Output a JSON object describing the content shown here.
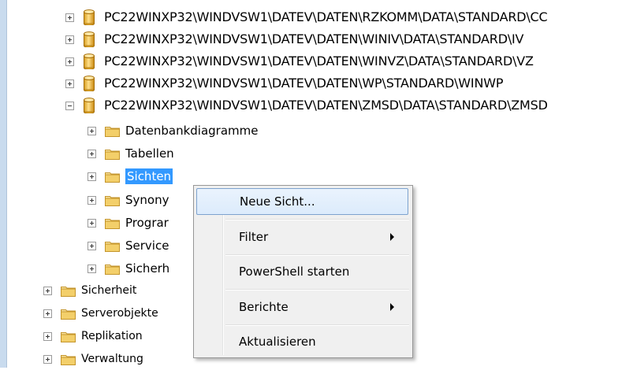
{
  "tree": {
    "databases": [
      {
        "label": "PC22WINXP32\\WINDVSW1\\DATEV\\DATEN\\RZKOMM\\DATA\\STANDARD\\CC",
        "expanded": false
      },
      {
        "label": "PC22WINXP32\\WINDVSW1\\DATEV\\DATEN\\WINIV\\DATA\\STANDARD\\IV",
        "expanded": false
      },
      {
        "label": "PC22WINXP32\\WINDVSW1\\DATEV\\DATEN\\WINVZ\\DATA\\STANDARD\\VZ",
        "expanded": false
      },
      {
        "label": "PC22WINXP32\\WINDVSW1\\DATEV\\DATEN\\WP\\STANDARD\\WINWP",
        "expanded": false
      },
      {
        "label": "PC22WINXP32\\WINDVSW1\\DATEV\\DATEN\\ZMSD\\DATA\\STANDARD\\ZMSD",
        "expanded": true
      }
    ],
    "zmsd_children": [
      {
        "label": "Datenbankdiagramme"
      },
      {
        "label": "Tabellen"
      },
      {
        "label": "Sichten",
        "selected": true
      },
      {
        "label": "Synony"
      },
      {
        "label": "Prograr"
      },
      {
        "label": "Service"
      },
      {
        "label": "Sicherh"
      }
    ],
    "server_nodes": [
      {
        "label": "Sicherheit"
      },
      {
        "label": "Serverobjekte"
      },
      {
        "label": "Replikation"
      },
      {
        "label": "Verwaltung"
      }
    ]
  },
  "context_menu": {
    "items": [
      {
        "label": "Neue Sicht...",
        "highlighted": true,
        "submenu": false
      },
      {
        "label": "Filter",
        "submenu": true
      },
      {
        "label": "PowerShell starten",
        "submenu": false
      },
      {
        "label": "Berichte",
        "submenu": true
      },
      {
        "label": "Aktualisieren",
        "submenu": false
      }
    ]
  },
  "colors": {
    "selection": "#3399ff",
    "menu_highlight_border": "#7da2ce",
    "folder": "#e8c35c",
    "database": "#e0b23c"
  },
  "icons": {
    "database": "database-icon",
    "folder": "folder-icon",
    "expand": "expand-plus-icon",
    "collapse": "collapse-minus-icon",
    "submenu": "submenu-arrow-icon"
  }
}
